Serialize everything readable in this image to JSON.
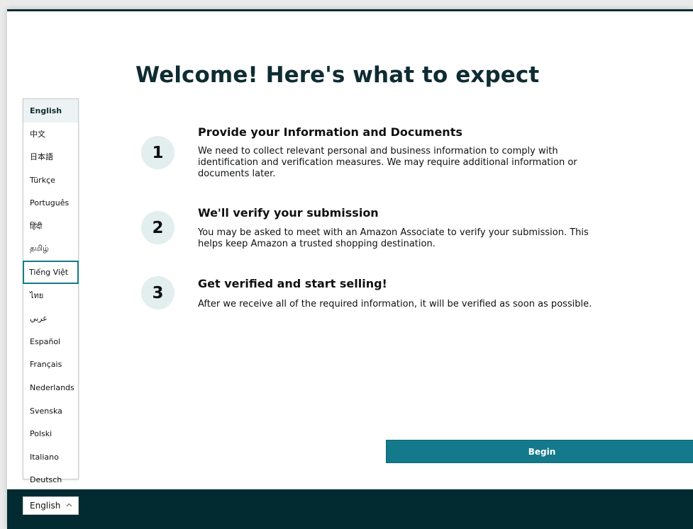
{
  "page": {
    "title": "Welcome! Here's what to expect"
  },
  "steps": [
    {
      "number": "1",
      "heading": "Provide your Information and Documents",
      "body": "We need to collect relevant personal and business information to comply with identification and verification measures. We may require additional information or documents later."
    },
    {
      "number": "2",
      "heading": "We'll verify your submission",
      "body": "You may be asked to meet with an Amazon Associate to verify your submission. This helps keep Amazon a trusted shopping destination."
    },
    {
      "number": "3",
      "heading": "Get verified and start selling!",
      "body": "After we receive all of the required information, it will be verified as soon as possible."
    }
  ],
  "actions": {
    "begin_label": "Begin"
  },
  "language_menu": {
    "selected": "English",
    "focused": "Tiếng Việt",
    "items": [
      "English",
      "中文",
      "日本語",
      "Türkçe",
      "Português",
      "हिंदी",
      "தமிழ்",
      "Tiếng Việt",
      "ไทย",
      "عربي",
      "Español",
      "Français",
      "Nederlands",
      "Svenska",
      "Polski",
      "Italiano",
      "Deutsch"
    ]
  },
  "language_selector": {
    "value": "English",
    "icon": "chevron-up-icon"
  },
  "colors": {
    "primary": "#147a8b",
    "title": "#0f2c33",
    "footer": "#012a31",
    "step_circle": "#e3eeee"
  }
}
